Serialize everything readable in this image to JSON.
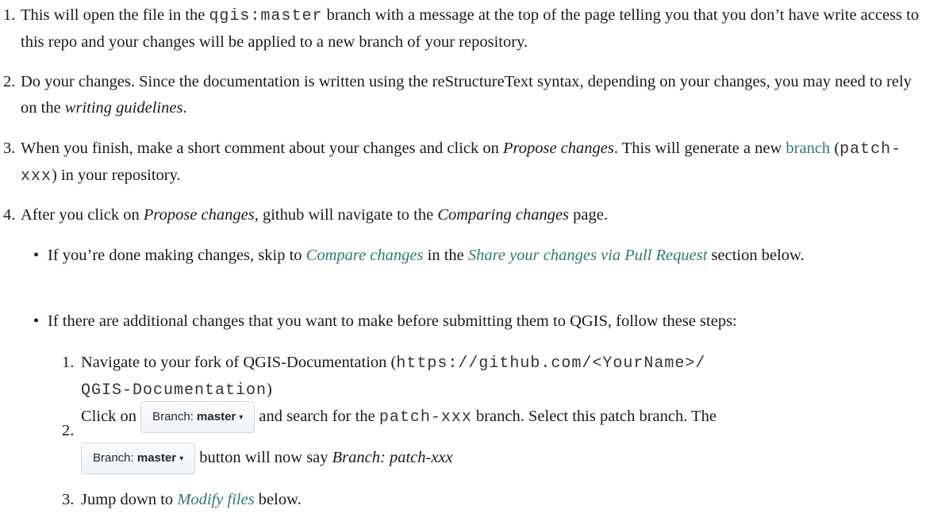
{
  "steps": [
    {
      "num": "1.",
      "parts": [
        "This will open the file in the ",
        "qgis:master",
        " branch with a message at the top of the page telling you that you don’t have write access to this repo and your changes will be applied to a new branch of your repository."
      ]
    },
    {
      "num": "2.",
      "parts": [
        "Do your changes. Since the documentation is written using the reStructureText syntax, depending on your changes, you may need to rely on the ",
        "writing guidelines",
        "."
      ]
    },
    {
      "num": "3.",
      "parts": [
        "When you finish, make a short comment about your changes and click on ",
        "Propose changes",
        ". This will generate a new ",
        "branch",
        " (",
        "patch-xxx",
        ") in your repository."
      ]
    },
    {
      "num": "4.",
      "parts": [
        "After you click on ",
        "Propose changes",
        ", github will navigate to the ",
        "Comparing changes",
        " page."
      ]
    }
  ],
  "bullets": [
    {
      "dot": "•",
      "parts": [
        "If you’re done making changes, skip to ",
        "Compare changes",
        " in the ",
        "Share your changes via Pull Request",
        " section below."
      ]
    },
    {
      "dot": "•",
      "parts": [
        "If there are additional changes that you want to make before submitting them to QGIS, follow these steps:"
      ]
    }
  ],
  "substeps": [
    {
      "num": "1.",
      "parts": [
        "Navigate to your fork of QGIS-Documentation (",
        "https://github.com/<YourName>/",
        "QGIS-Documentation",
        ")"
      ]
    },
    {
      "num": "2.",
      "parts": [
        "Click on ",
        " and search for the ",
        "patch-xxx",
        " branch. Select this patch branch. The ",
        " button will now say ",
        "Branch: patch-xxx"
      ]
    },
    {
      "num": "3.",
      "parts": [
        "Jump down to ",
        "Modify files",
        " below."
      ]
    }
  ],
  "branch_button": {
    "prefix": "Branch: ",
    "name": "master",
    "caret": "▾"
  }
}
